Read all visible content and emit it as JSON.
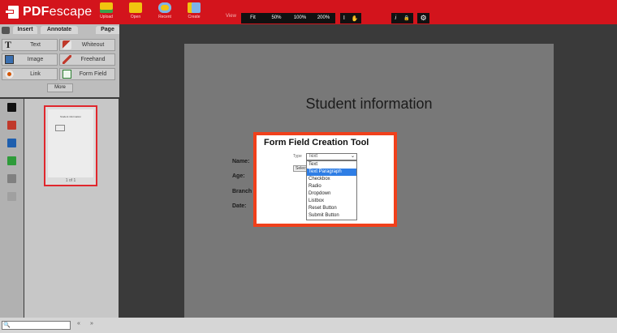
{
  "app": {
    "logo": {
      "bold": "PDF",
      "rest": "escape"
    }
  },
  "toolbar": {
    "icons": [
      {
        "name": "upload-icon",
        "label": "Upload",
        "color": "#f1c40f"
      },
      {
        "name": "folder-icon",
        "label": "Open",
        "color": "#f1c40f"
      },
      {
        "name": "clock-icon",
        "label": "Recent",
        "color": "#7fb3e8"
      },
      {
        "name": "tag-icon",
        "label": "Create",
        "color": "#7fb3e8"
      }
    ],
    "view_label": "View",
    "zoom_options": [
      "Fit",
      "50%",
      "100%",
      "200%"
    ],
    "text_tool_glyph": "I",
    "hand_tool_glyph": "✋",
    "info_glyph": "i",
    "lock_glyph": "🔒",
    "gear_glyph": "⚙"
  },
  "tools": {
    "tabs": [
      "Insert",
      "Annotate",
      "Page"
    ],
    "buttons": [
      {
        "name": "text-tool-button",
        "icon": "text-icon",
        "label": "Text"
      },
      {
        "name": "whiteout-tool-button",
        "icon": "whiteout-icon",
        "label": "Whiteout"
      },
      {
        "name": "image-tool-button",
        "icon": "image-icon",
        "label": "Image"
      },
      {
        "name": "freehand-tool-button",
        "icon": "pencil-icon",
        "label": "Freehand"
      },
      {
        "name": "link-tool-button",
        "icon": "link-icon",
        "label": "Link"
      },
      {
        "name": "form-field-tool-button",
        "icon": "form-field-icon",
        "label": "Form Field"
      }
    ],
    "more_label": "More"
  },
  "sidebar": {
    "icons": [
      {
        "name": "pages-icon",
        "color": "#111111"
      },
      {
        "name": "pdf-file-icon",
        "color": "#c0392b"
      },
      {
        "name": "save-icon",
        "color": "#1f5fae"
      },
      {
        "name": "checkbox-icon",
        "color": "#2e9b3a"
      },
      {
        "name": "print-icon",
        "color": "#808080"
      },
      {
        "name": "share-icon",
        "color": "#a0a0a0"
      }
    ],
    "thumbnail": {
      "title": "Student information",
      "page_number": "1 of 1"
    }
  },
  "document": {
    "title": "Student information",
    "labels": [
      "Name:",
      "Age:",
      "Branch",
      "Date:"
    ]
  },
  "modal": {
    "title": "Form Field Creation Tool",
    "type_label": "Type",
    "selected_value": "Text",
    "select_button": "Select",
    "options": [
      "Text",
      "Text Paragraph",
      "Checkbox",
      "Radio",
      "Dropdown",
      "Listbox",
      "Reset Button",
      "Submit Button"
    ],
    "highlighted_option": 1
  },
  "bottom": {
    "search_glyph": "🔍",
    "prev_glyph": "«",
    "next_glyph": "»"
  },
  "colors": {
    "brand": "#d3141c",
    "modal_border": "#f0401b",
    "highlight": "#2f7ee5"
  }
}
